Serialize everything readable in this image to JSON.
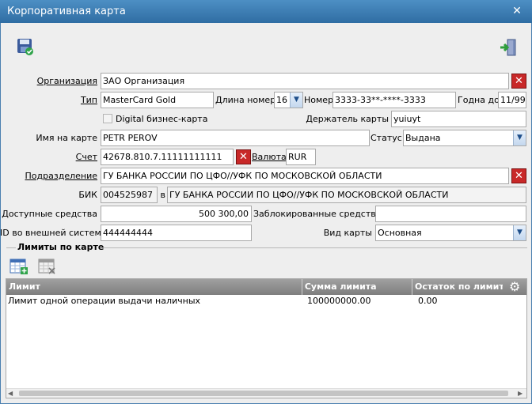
{
  "window": {
    "title": "Корпоративная карта",
    "close_glyph": "✕"
  },
  "toolbar": {
    "save_icon": "save-floppy-icon",
    "exit_icon": "exit-door-icon"
  },
  "form": {
    "org_label": "Организация",
    "org_value": "ЗАО Организация",
    "type_label": "Тип",
    "type_value": "MasterCard Gold",
    "numlen_label": "Длина номера",
    "numlen_value": "16",
    "number_label": "Номер",
    "number_value": "3333-33**-****-3333",
    "valid_label": "Годна до",
    "valid_value": "11/99",
    "digital_label": "Digital бизнес-карта",
    "holder_label": "Держатель карты",
    "holder_value": "yuiuyt",
    "name_label": "Имя на карте",
    "name_value": "PETR PEROV",
    "status_label": "Статус",
    "status_value": "Выдана",
    "account_label": "Счет",
    "account_value": "42678.810.7.11111111111",
    "currency_label": "Валюта",
    "currency_value": "RUR",
    "division_label": "Подразделение",
    "division_value": "ГУ БАНКА РОССИИ ПО ЦФО//УФК ПО МОСКОВСКОЙ ОБЛАСТИ",
    "bik_label": "БИК",
    "bik_value": "004525987",
    "in_label": "в",
    "bank_value": "ГУ БАНКА РОССИИ ПО ЦФО//УФК ПО МОСКОВСКОЙ ОБЛАСТИ",
    "avail_label": "Доступные средства",
    "avail_value": "500 300,00",
    "blocked_label": "Заблокированные средства",
    "blocked_value": "",
    "extid_label": "ID во внешней системе",
    "extid_value": "444444444",
    "cardkind_label": "Вид карты",
    "cardkind_value": "Основная",
    "x_glyph": "✕",
    "dd_glyph": "▼"
  },
  "limits": {
    "section_title": "Лимиты по карте",
    "columns": [
      "Лимит",
      "Сумма лимита",
      "Остаток по лимиту"
    ],
    "rows": [
      {
        "limit": "Лимит одной операции выдачи наличных",
        "amount": "100000000.00",
        "rest": "0.00"
      }
    ],
    "settings_glyph": "⚙"
  }
}
